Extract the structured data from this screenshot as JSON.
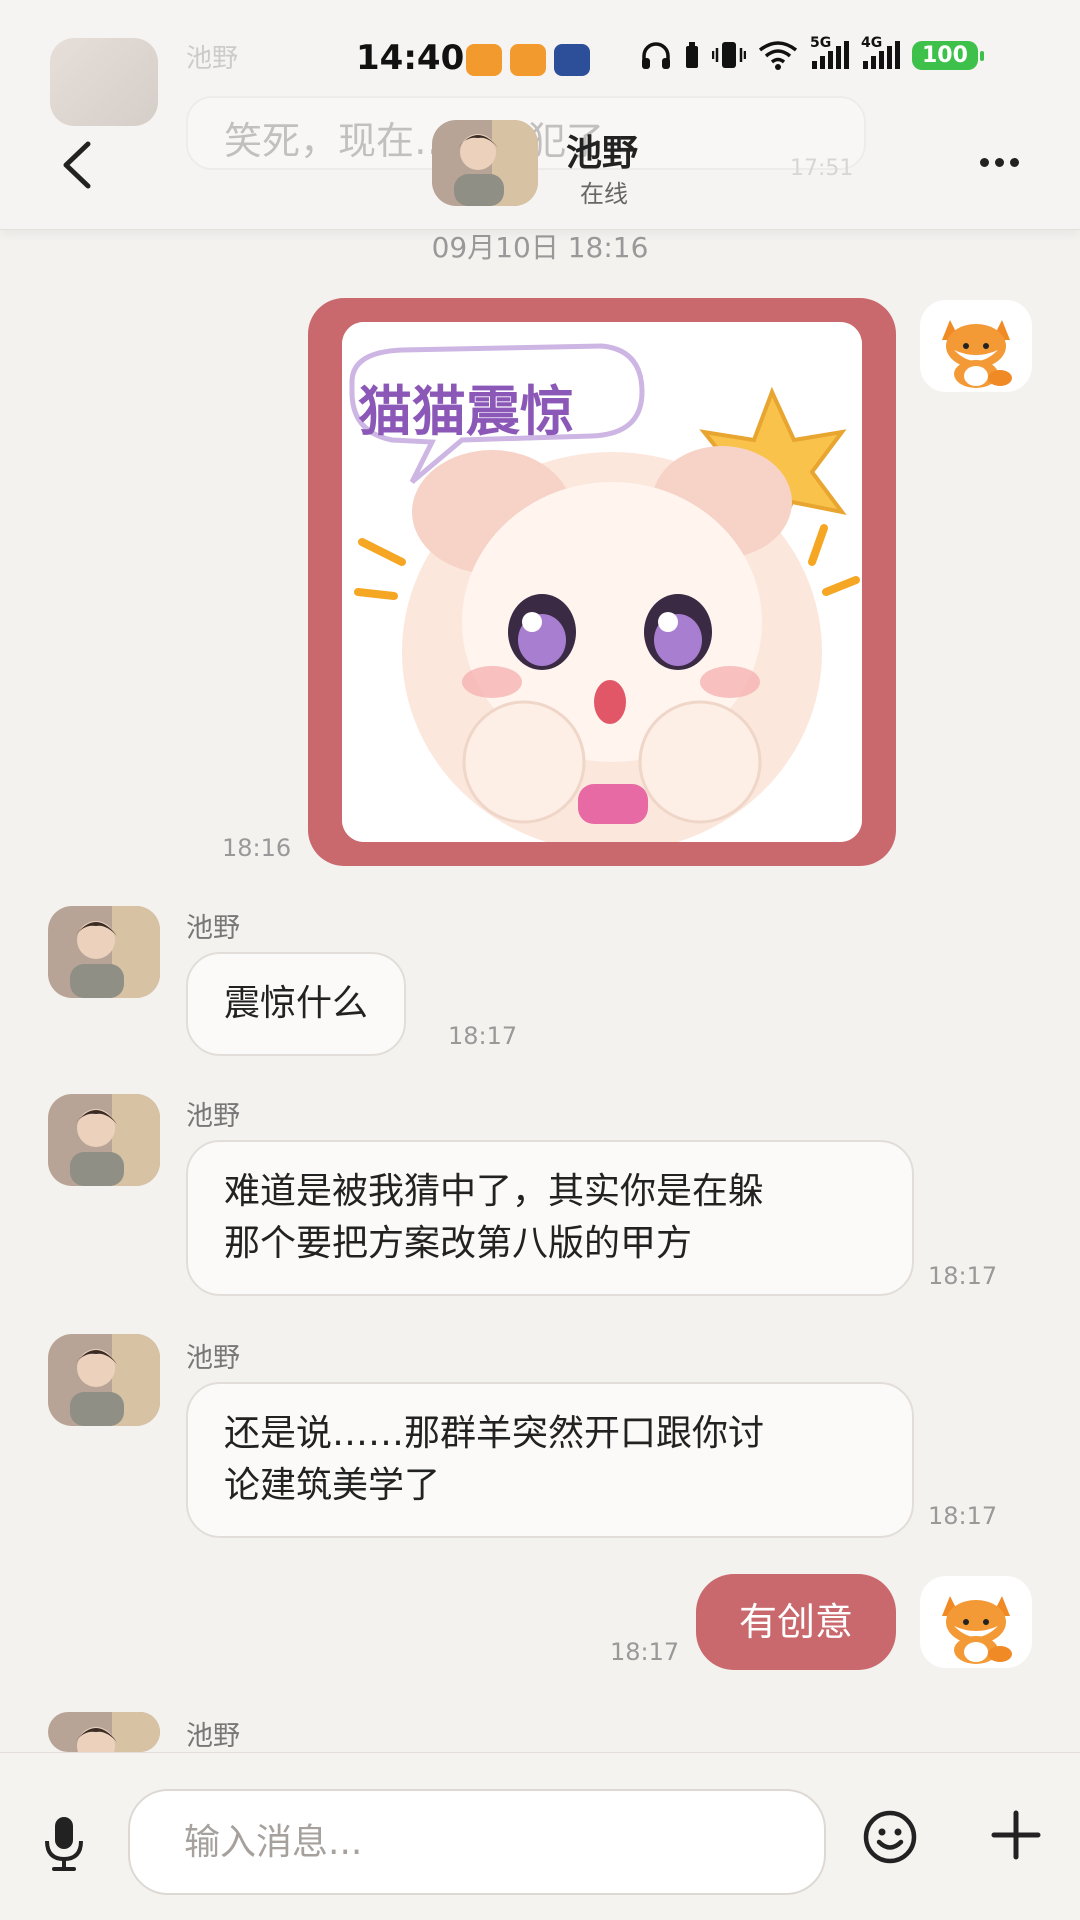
{
  "status_bar": {
    "time": "14:40",
    "net_5g": "5G",
    "net_4g": "4G",
    "battery": "100",
    "battery_color": "#3ec14b"
  },
  "header": {
    "contact_name": "池野",
    "contact_status": "在线",
    "back_icon": "chevron-left-icon",
    "more_icon": "more-horizontal-icon"
  },
  "ghost_preview": {
    "sender": "池野",
    "text": "笑死，现在…算…犯了",
    "time": "17:51"
  },
  "chat": {
    "date_separator": "09月10日 18:16",
    "messages": [
      {
        "side": "right",
        "type": "sticker",
        "sticker_text": "猫猫震惊",
        "time": "18:16"
      },
      {
        "side": "left",
        "sender": "池野",
        "text": "震惊什么",
        "time": "18:17"
      },
      {
        "side": "left",
        "sender": "池野",
        "lines": [
          "难道是被我猜中了，其实你是在躲",
          "那个要把方案改第八版的甲方"
        ],
        "time": "18:17"
      },
      {
        "side": "left",
        "sender": "池野",
        "lines": [
          "还是说……那群羊突然开口跟你讨",
          "论建筑美学了"
        ],
        "time": "18:17"
      },
      {
        "side": "right",
        "type": "text",
        "text": "有创意",
        "time": "18:17"
      },
      {
        "side": "left",
        "sender": "池野",
        "text": ""
      }
    ]
  },
  "input_bar": {
    "placeholder": "输入消息...",
    "mic_icon": "microphone-icon",
    "emoji_icon": "smiley-icon",
    "plus_icon": "plus-icon"
  },
  "colors": {
    "accent": "#c9696d",
    "background": "#f4f2ef",
    "bubble_left": "#fbfaf9"
  }
}
